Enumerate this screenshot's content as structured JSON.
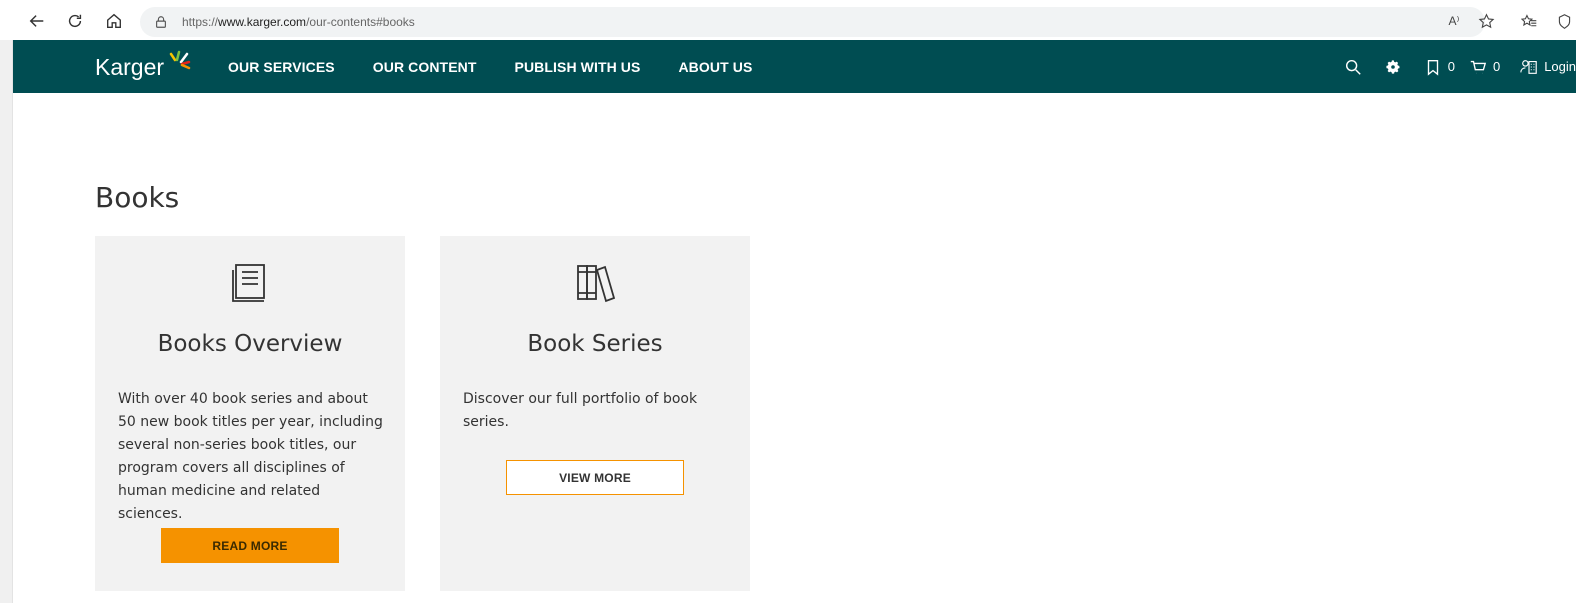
{
  "browser": {
    "url_prefix": "https://",
    "url_domain": "www.karger.com",
    "url_path": "/our-contents#books",
    "icons": [
      "back-icon",
      "refresh-icon",
      "home-icon",
      "lock-icon",
      "read-aloud-icon",
      "add-favorite-icon",
      "favorites-icon",
      "extensions-icon"
    ],
    "read_aloud_label": "A⁾"
  },
  "site": {
    "logo_text": "Karger",
    "brand_color": "#004d52",
    "accent_color": "#f59200",
    "nav": [
      "OUR SERVICES",
      "OUR CONTENT",
      "PUBLISH WITH US",
      "ABOUT US"
    ],
    "bookmarks_count": "0",
    "cart_count": "0",
    "login_label": "Login"
  },
  "page": {
    "title": "Books",
    "cards": [
      {
        "icon": "book-icon",
        "title": "Books Overview",
        "text": "With over 40 book series and about 50 new book titles per year, including several non-series book titles, our program covers all disciplines of human medicine and related sciences.",
        "button": "READ MORE"
      },
      {
        "icon": "book-series-icon",
        "title": "Book Series",
        "text": "Discover our full portfolio of book series.",
        "button": "VIEW MORE"
      }
    ]
  }
}
